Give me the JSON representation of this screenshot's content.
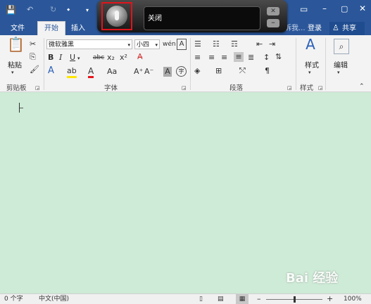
{
  "tabs": {
    "file": "文件",
    "home": "开始",
    "insert": "插入",
    "more": "告诉我...",
    "login": "登录",
    "share": "共享"
  },
  "voice": {
    "status": "关闭"
  },
  "font": {
    "name": "微软雅黑",
    "size": "小四"
  },
  "groups": {
    "clipboard": "剪贴板",
    "font": "字体",
    "paragraph": "段落",
    "styles": "样式"
  },
  "buttons": {
    "paste": "粘贴",
    "styles": "样式",
    "edit": "编辑",
    "bold": "B",
    "italic": "I",
    "underline": "U",
    "strike": "abc",
    "sub": "x₂",
    "sup": "x²",
    "font_color": "A",
    "aa": "Aa"
  },
  "status": {
    "words": "0 个字",
    "language": "中文(中国)",
    "zoom": "100%"
  },
  "watermark": "Bai 经验"
}
